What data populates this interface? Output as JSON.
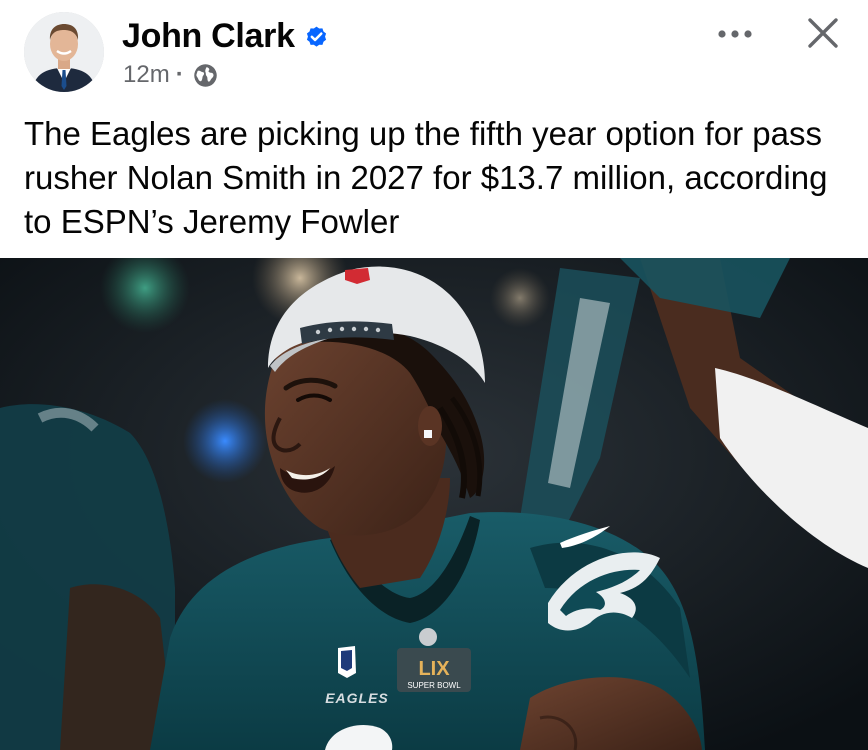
{
  "post": {
    "author_name": "John Clark",
    "verified": true,
    "timestamp": "12m",
    "separator": "·",
    "audience_icon": "globe-icon",
    "text": "The Eagles are picking up the fifth year option for pass rusher Nolan Smith in 2027 for $13.7 million, according to ESPN’s Jeremy Fowler",
    "image": {
      "jersey_wordmark": "EAGLES",
      "patch_text": "SUPER BOWL",
      "patch_numeral": "LIX"
    }
  },
  "actions": {
    "more_icon": "more-horizontal-icon",
    "close_icon": "close-icon"
  },
  "colors": {
    "text_primary": "#050505",
    "text_secondary": "#65676b",
    "verified_blue": "#0866ff",
    "jersey_green": "#0f4a55"
  }
}
